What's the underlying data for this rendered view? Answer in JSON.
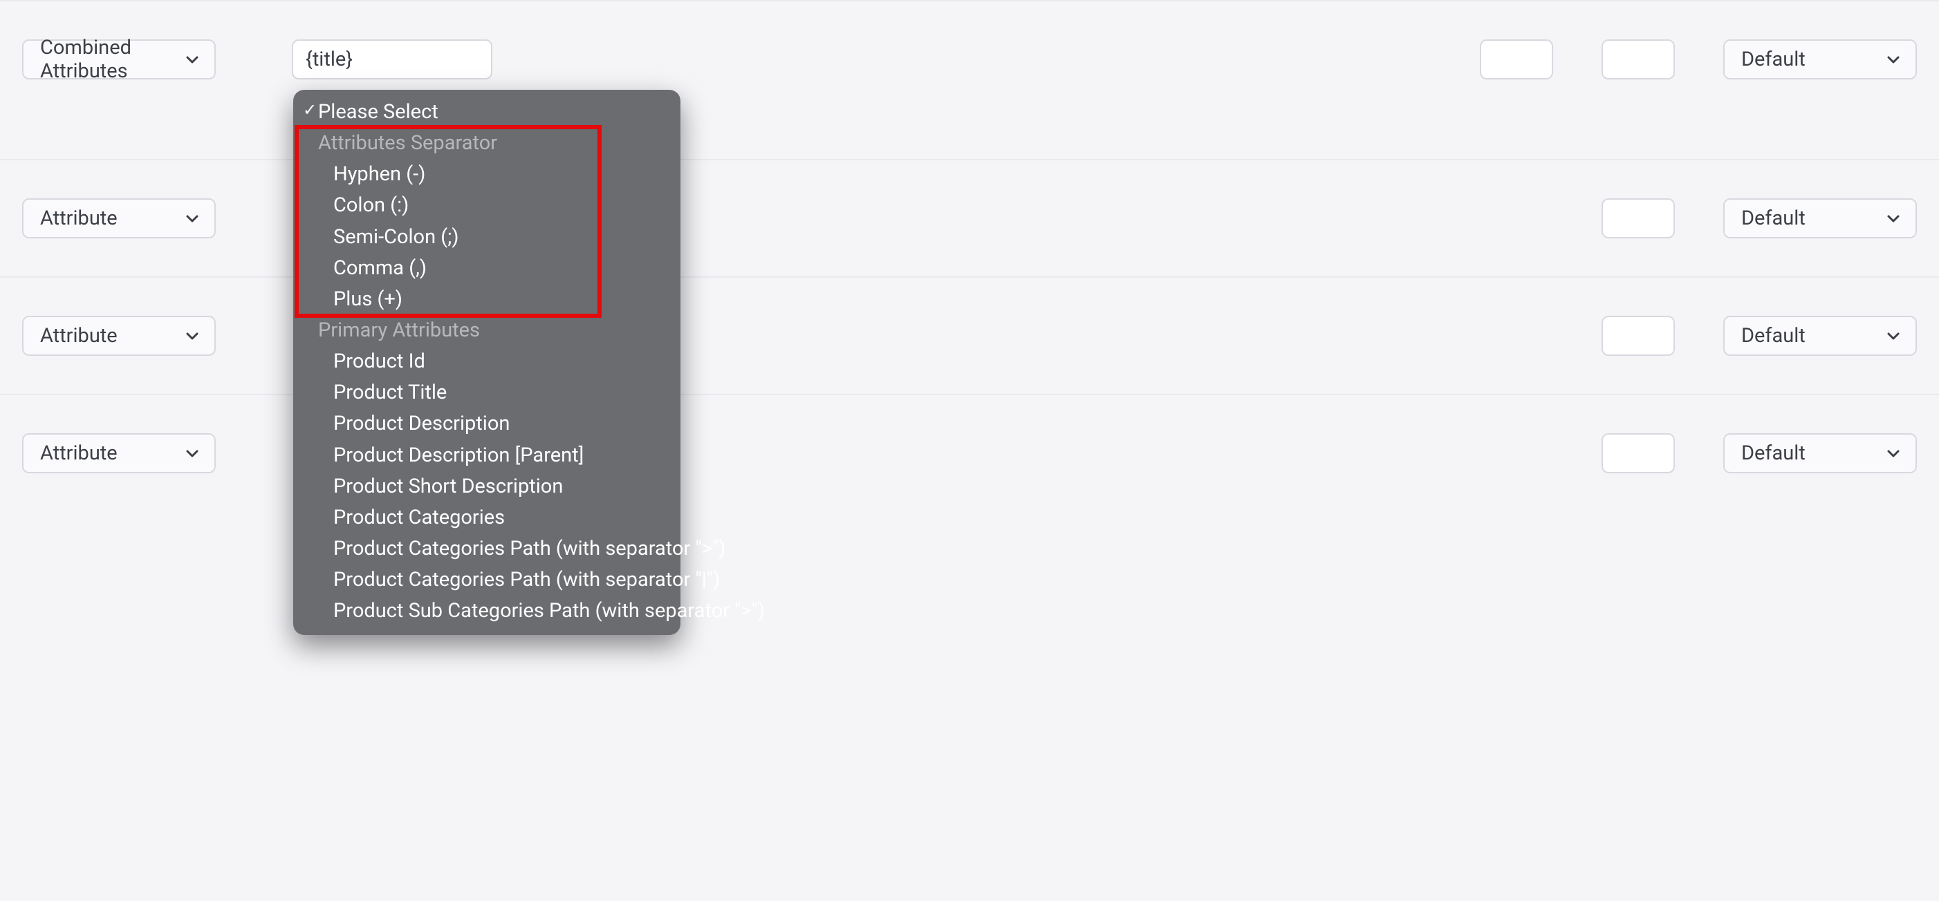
{
  "rows": [
    {
      "attr_label": "Combined Attributes",
      "value": "{title}",
      "default_label": "Default"
    },
    {
      "attr_label": "Attribute",
      "value": "",
      "default_label": "Default"
    },
    {
      "attr_label": "Attribute",
      "value": "",
      "default_label": "Default"
    },
    {
      "attr_label": "Attribute",
      "value": "",
      "default_label": "Default"
    }
  ],
  "dropdown": {
    "selected": "Please Select",
    "groups": [
      {
        "label": "Attributes Separator",
        "items": [
          "Hyphen (-)",
          "Colon (:)",
          "Semi-Colon (;)",
          "Comma (,)",
          "Plus (+)"
        ]
      },
      {
        "label": "Primary Attributes",
        "items": [
          "Product Id",
          "Product Title",
          "Product Description",
          "Product Description [Parent]",
          "Product Short Description",
          "Product Categories",
          "Product Categories Path (with separator \">\")",
          "Product Categories Path (with separator \"|\")",
          "Product Sub Categories Path (with separator \">\")"
        ]
      }
    ]
  }
}
